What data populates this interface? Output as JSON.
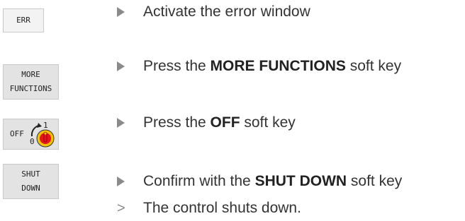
{
  "keys": {
    "err": {
      "label": "ERR"
    },
    "more": {
      "line1": "MORE",
      "line2": "FUNCTIONS"
    },
    "off": {
      "label": "OFF",
      "dial_top": "1",
      "dial_bottom": "0",
      "switch_color": "#e8141c",
      "switch_bg": "#f5c400"
    },
    "shut": {
      "line1": "SHUT",
      "line2": "DOWN"
    }
  },
  "steps": [
    {
      "text": "Activate the error window"
    },
    {
      "pre": "Press the ",
      "bold": "MORE FUNCTIONS",
      "post": " soft key"
    },
    {
      "pre": "Press the ",
      "bold": "OFF",
      "post": " soft key"
    },
    {
      "pre": "Confirm with the ",
      "bold": "SHUT DOWN",
      "post": " soft key"
    }
  ],
  "result": {
    "marker": ">",
    "text": "The control shuts down."
  },
  "colors": {
    "arrow": "#8a8a8a",
    "text": "#333333",
    "key_border": "#c9c9c9"
  }
}
